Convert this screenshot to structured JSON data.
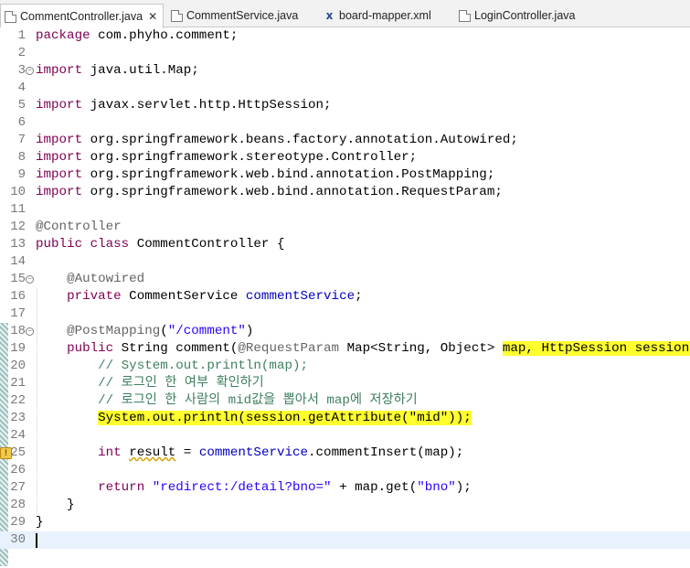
{
  "tabs": [
    {
      "label": "CommentController.java",
      "icon": "java-file-icon",
      "active": true,
      "closable": true
    },
    {
      "label": "CommentService.java",
      "icon": "java-file-icon",
      "active": false,
      "closable": false
    },
    {
      "label": "board-mapper.xml",
      "icon": "xml-file-icon",
      "active": false,
      "closable": false
    },
    {
      "label": "LoginController.java",
      "icon": "java-file-icon",
      "active": false,
      "closable": false
    }
  ],
  "close_glyph": "✕",
  "xml_glyph": "x",
  "lines": [
    {
      "n": "1",
      "t": [
        [
          "kw",
          "package"
        ],
        [
          "",
          "com.phyho.comment;"
        ]
      ]
    },
    {
      "n": "2",
      "t": []
    },
    {
      "n": "3",
      "fold": true,
      "t": [
        [
          "kw",
          "import"
        ],
        [
          "",
          "java.util.Map;"
        ]
      ]
    },
    {
      "n": "4",
      "t": []
    },
    {
      "n": "5",
      "t": [
        [
          "kw",
          "import"
        ],
        [
          "",
          "javax.servlet.http.HttpSession;"
        ]
      ]
    },
    {
      "n": "6",
      "t": []
    },
    {
      "n": "7",
      "t": [
        [
          "kw",
          "import"
        ],
        [
          "",
          "org.springframework.beans.factory.annotation.Autowired;"
        ]
      ]
    },
    {
      "n": "8",
      "t": [
        [
          "kw",
          "import"
        ],
        [
          "",
          "org.springframework.stereotype.Controller;"
        ]
      ]
    },
    {
      "n": "9",
      "t": [
        [
          "kw",
          "import"
        ],
        [
          "",
          "org.springframework.web.bind.annotation.PostMapping;"
        ]
      ]
    },
    {
      "n": "10",
      "t": [
        [
          "kw",
          "import"
        ],
        [
          "",
          "org.springframework.web.bind.annotation.RequestParam;"
        ]
      ]
    },
    {
      "n": "11",
      "t": []
    },
    {
      "n": "12",
      "t": [
        [
          "ann",
          "@Controller"
        ]
      ]
    },
    {
      "n": "13",
      "t": [
        [
          "kw",
          "public"
        ],
        [
          "",
          " "
        ],
        [
          "kw",
          "class"
        ],
        [
          "",
          " CommentController {"
        ]
      ]
    },
    {
      "n": "14",
      "t": []
    },
    {
      "n": "15",
      "fold": true,
      "t": [
        [
          "",
          "    "
        ],
        [
          "ann",
          "@Autowired"
        ]
      ]
    },
    {
      "n": "16",
      "t": [
        [
          "",
          "    "
        ],
        [
          "kw",
          "private"
        ],
        [
          "",
          " CommentService "
        ],
        [
          "fld",
          "commentService"
        ],
        [
          "",
          ";"
        ]
      ]
    },
    {
      "n": "17",
      "t": []
    },
    {
      "n": "18",
      "fold": true,
      "t": [
        [
          "",
          "    "
        ],
        [
          "ann",
          "@PostMapping"
        ],
        [
          "",
          "("
        ],
        [
          "str",
          "\"/comment\""
        ],
        [
          "",
          ")"
        ]
      ]
    },
    {
      "n": "19",
      "t": [
        [
          "",
          "    "
        ],
        [
          "kw",
          "public"
        ],
        [
          "",
          " String comment("
        ],
        [
          "ann",
          "@RequestParam"
        ],
        [
          "",
          " Map<String, Object> "
        ],
        [
          "hl",
          "map, HttpSession session)"
        ],
        [
          "",
          " {"
        ]
      ]
    },
    {
      "n": "20",
      "t": [
        [
          "",
          "        "
        ],
        [
          "cmt",
          "// System.out.println(map);"
        ]
      ]
    },
    {
      "n": "21",
      "t": [
        [
          "",
          "        "
        ],
        [
          "cmt",
          "// 로그인 한 여부 확인하기"
        ]
      ]
    },
    {
      "n": "22",
      "t": [
        [
          "",
          "        "
        ],
        [
          "cmt",
          "// 로그인 한 사람의 mid값을 뽑아서 map에 저장하기"
        ]
      ]
    },
    {
      "n": "23",
      "t": [
        [
          "",
          "        "
        ],
        [
          "hl",
          "System.out.println(session.getAttribute(\"mid\"));"
        ]
      ]
    },
    {
      "n": "24",
      "t": []
    },
    {
      "n": "25",
      "warn": true,
      "t": [
        [
          "",
          "        "
        ],
        [
          "kw",
          "int"
        ],
        [
          "",
          " "
        ],
        [
          "warn",
          "result"
        ],
        [
          "",
          " = "
        ],
        [
          "fld",
          "commentService"
        ],
        [
          "",
          ".commentInsert(map);"
        ]
      ]
    },
    {
      "n": "26",
      "t": []
    },
    {
      "n": "27",
      "t": [
        [
          "",
          "        "
        ],
        [
          "kw",
          "return"
        ],
        [
          "",
          " "
        ],
        [
          "str",
          "\"redirect:/detail?bno=\""
        ],
        [
          "",
          " + map.get("
        ],
        [
          "str",
          "\"bno\""
        ],
        [
          "",
          ");"
        ]
      ]
    },
    {
      "n": "28",
      "t": [
        [
          "",
          "    }"
        ]
      ]
    },
    {
      "n": "29",
      "t": [
        [
          "",
          "}"
        ]
      ]
    },
    {
      "n": "30",
      "current": true,
      "t": []
    }
  ]
}
